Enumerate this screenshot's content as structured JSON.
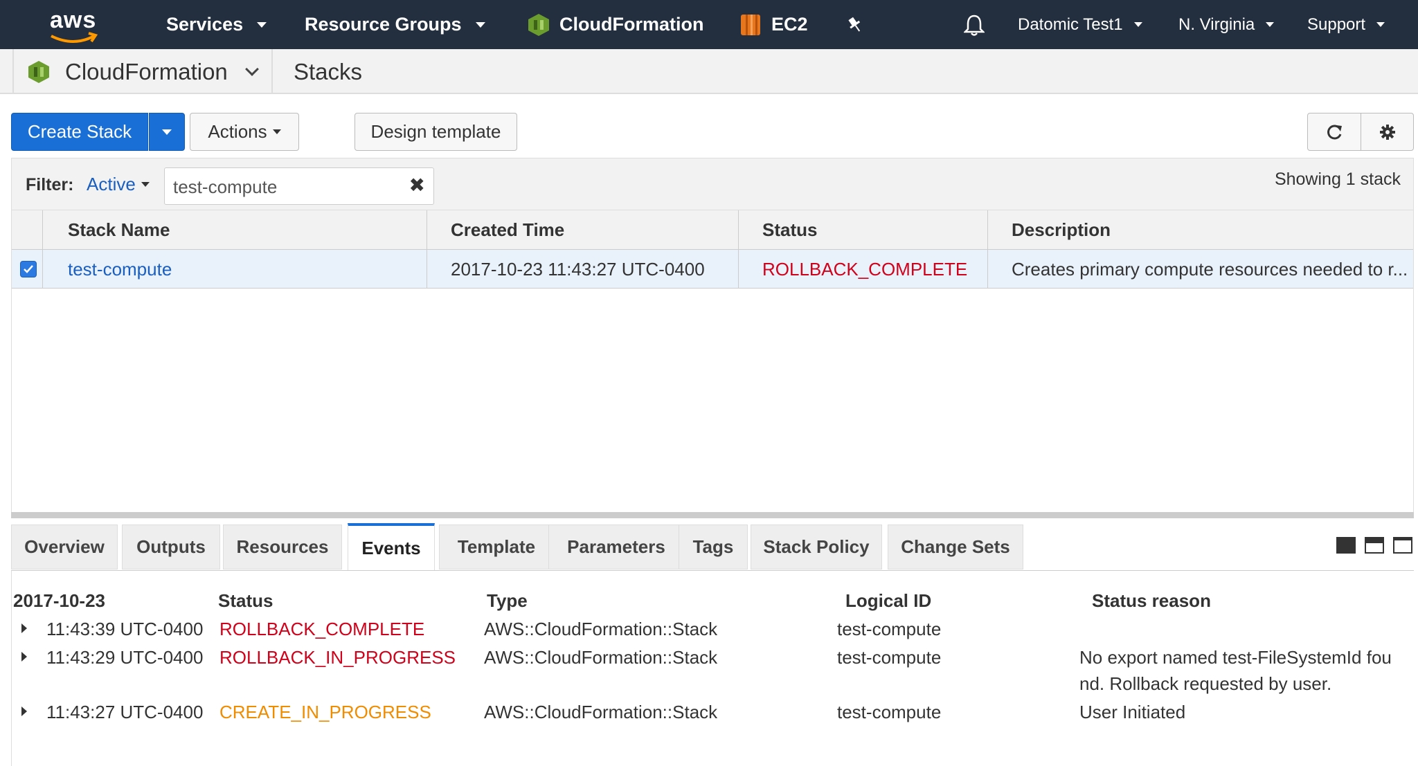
{
  "topnav": {
    "logo_text": "aws",
    "services": "Services",
    "resource_groups": "Resource Groups",
    "cloudformation": "CloudFormation",
    "ec2": "EC2",
    "account": "Datomic Test1",
    "region": "N. Virginia",
    "support": "Support"
  },
  "subbar": {
    "service": "CloudFormation",
    "page": "Stacks"
  },
  "toolbar": {
    "create_stack": "Create Stack",
    "actions": "Actions",
    "design_template": "Design template"
  },
  "filter": {
    "label": "Filter:",
    "mode": "Active",
    "value": "test-compute",
    "showing": "Showing 1 stack"
  },
  "stacks_table": {
    "headers": [
      "Stack Name",
      "Created Time",
      "Status",
      "Description"
    ],
    "rows": [
      {
        "name": "test-compute",
        "created": "2017-10-23 11:43:27 UTC-0400",
        "status": "ROLLBACK_COMPLETE",
        "description": "Creates primary compute resources needed to r..."
      }
    ]
  },
  "tabs": [
    "Overview",
    "Outputs",
    "Resources",
    "Events",
    "Template",
    "Parameters",
    "Tags",
    "Stack Policy",
    "Change Sets"
  ],
  "active_tab": "Events",
  "events": {
    "headers": {
      "date": "2017-10-23",
      "status": "Status",
      "type": "Type",
      "logical_id": "Logical ID",
      "reason": "Status reason"
    },
    "rows": [
      {
        "time": "11:43:39 UTC-0400",
        "status": "ROLLBACK_COMPLETE",
        "type": "AWS::CloudFormation::Stack",
        "logical_id": "test-compute",
        "reason_1": "",
        "reason_2": ""
      },
      {
        "time": "11:43:29 UTC-0400",
        "status": "ROLLBACK_IN_PROGRESS",
        "type": "AWS::CloudFormation::Stack",
        "logical_id": "test-compute",
        "reason_1": "No export named test-FileSystemId fou",
        "reason_2": "nd. Rollback requested by user."
      },
      {
        "time": "11:43:27 UTC-0400",
        "status": "CREATE_IN_PROGRESS",
        "type": "AWS::CloudFormation::Stack",
        "logical_id": "test-compute",
        "reason_1": "User Initiated",
        "reason_2": ""
      }
    ]
  },
  "colors": {
    "nav_bg": "#232f3e",
    "primary": "#1a6fd6",
    "status_red": "#d0021b",
    "status_orange": "#f08c00",
    "selected_row": "#e9f2fb"
  }
}
